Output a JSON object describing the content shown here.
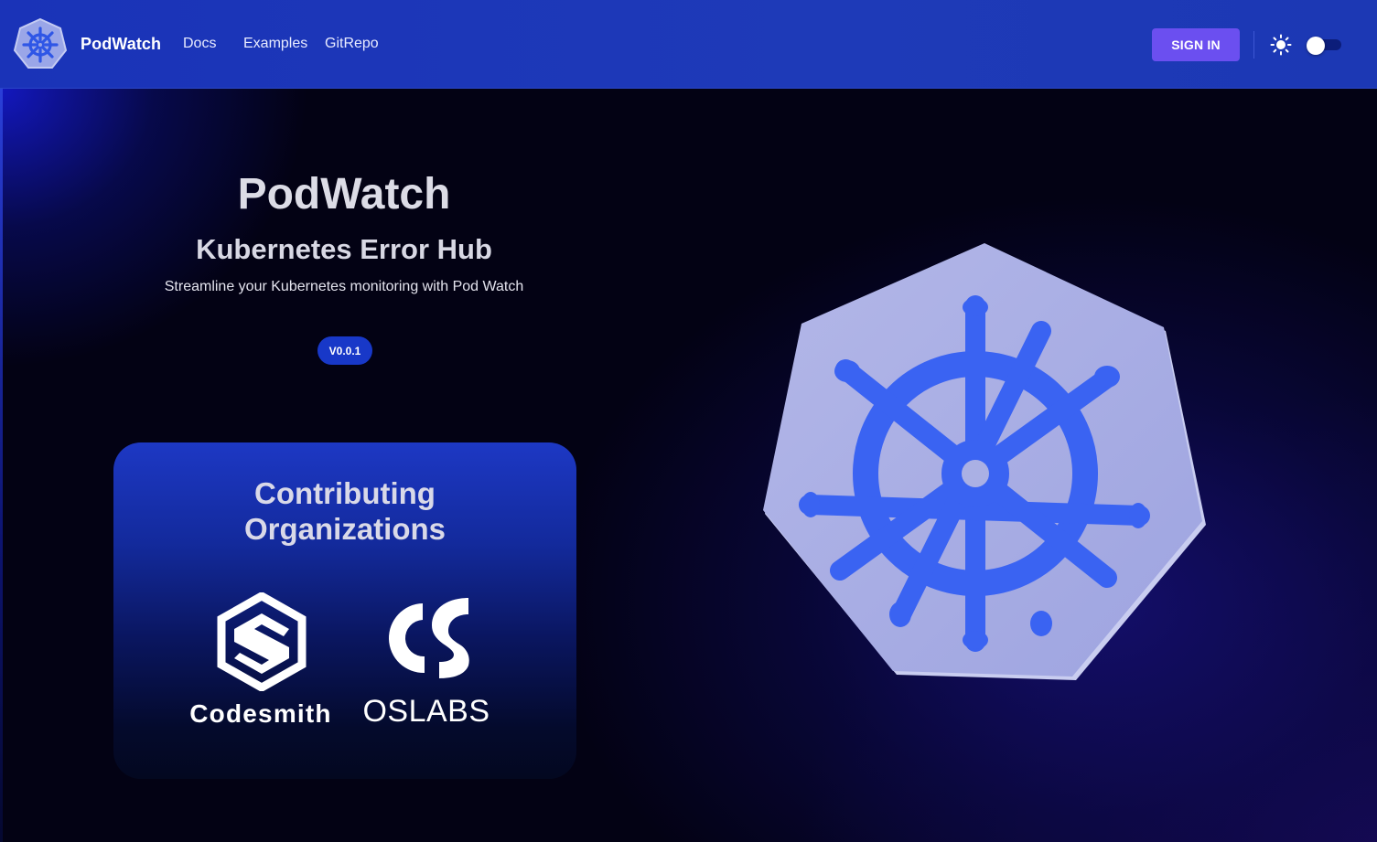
{
  "navbar": {
    "brand": "PodWatch",
    "links": [
      "Docs",
      "Examples",
      "GitRepo"
    ],
    "sign_in": "SIGN IN",
    "theme_icon": "sun-icon",
    "toggle_state": "off"
  },
  "hero": {
    "title": "PodWatch",
    "subtitle": "Kubernetes Error Hub",
    "tagline": "Streamline your Kubernetes monitoring with Pod Watch",
    "version": "V0.0.1"
  },
  "contributors": {
    "title_line1": "Contributing",
    "title_line2": "Organizations",
    "orgs": [
      "Codesmith",
      "OSLABS"
    ]
  },
  "colors": {
    "navbar": "#1c38b4",
    "accent_button": "#6b4ff0",
    "kubernetes_blue": "#3a63f2"
  },
  "icons": [
    "kubernetes-logo-icon",
    "sun-icon",
    "codesmith-logo-icon",
    "oslabs-logo-icon"
  ]
}
